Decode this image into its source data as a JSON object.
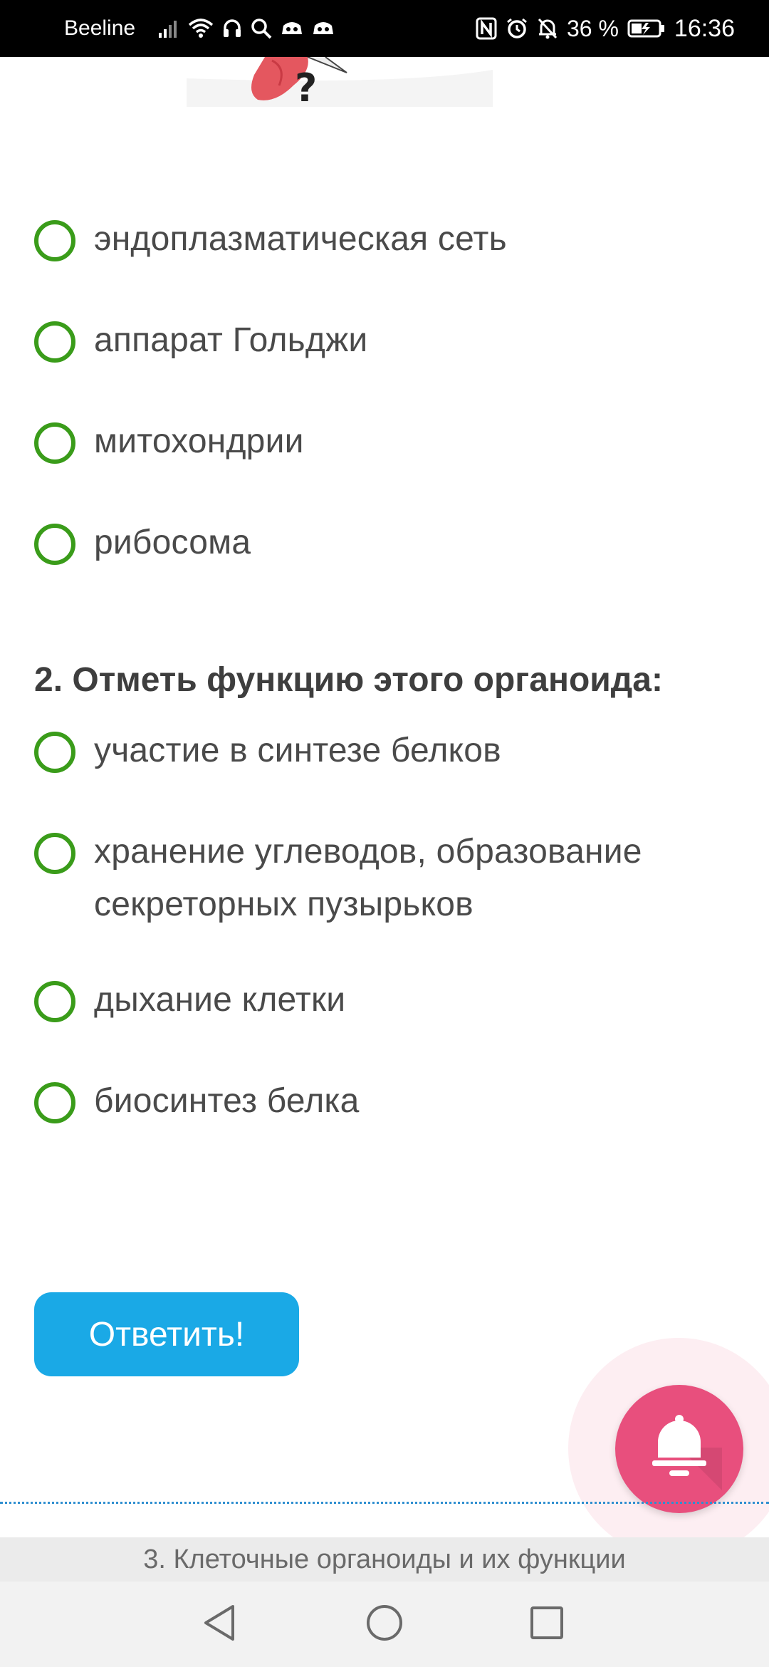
{
  "status_bar": {
    "carrier": "Beeline",
    "battery_percent": "36 %",
    "time": "16:36",
    "icons": [
      "signal-icon",
      "wifi-icon",
      "headset-icon",
      "search-icon",
      "app-icon",
      "app-icon",
      "nfc-icon",
      "alarm-icon",
      "mute-notifications-icon",
      "battery-charging-icon"
    ]
  },
  "question1": {
    "options": [
      {
        "label": "эндоплазматическая сеть"
      },
      {
        "label": "аппарат Гольджи"
      },
      {
        "label": "митохондрии"
      },
      {
        "label": "рибосома"
      }
    ]
  },
  "question2": {
    "title": "2. Отметь функцию этого органоида:",
    "options": [
      {
        "label": "участие в синтезе белков"
      },
      {
        "label": "хранение углеводов, образование секреторных пузырьков"
      },
      {
        "label": "дыхание клетки"
      },
      {
        "label": "биосинтез белка"
      }
    ]
  },
  "submit": {
    "label": "Ответить!"
  },
  "footer": {
    "section_title": "3. Клеточные органоиды и их функции"
  },
  "colors": {
    "radio_border": "#3a9c1a",
    "submit_bg": "#1aa9e6",
    "fab_bg": "#e84f7d",
    "divider": "#2f8fd0"
  },
  "nav": {
    "icons": [
      "back-icon",
      "home-icon",
      "recents-icon"
    ]
  }
}
